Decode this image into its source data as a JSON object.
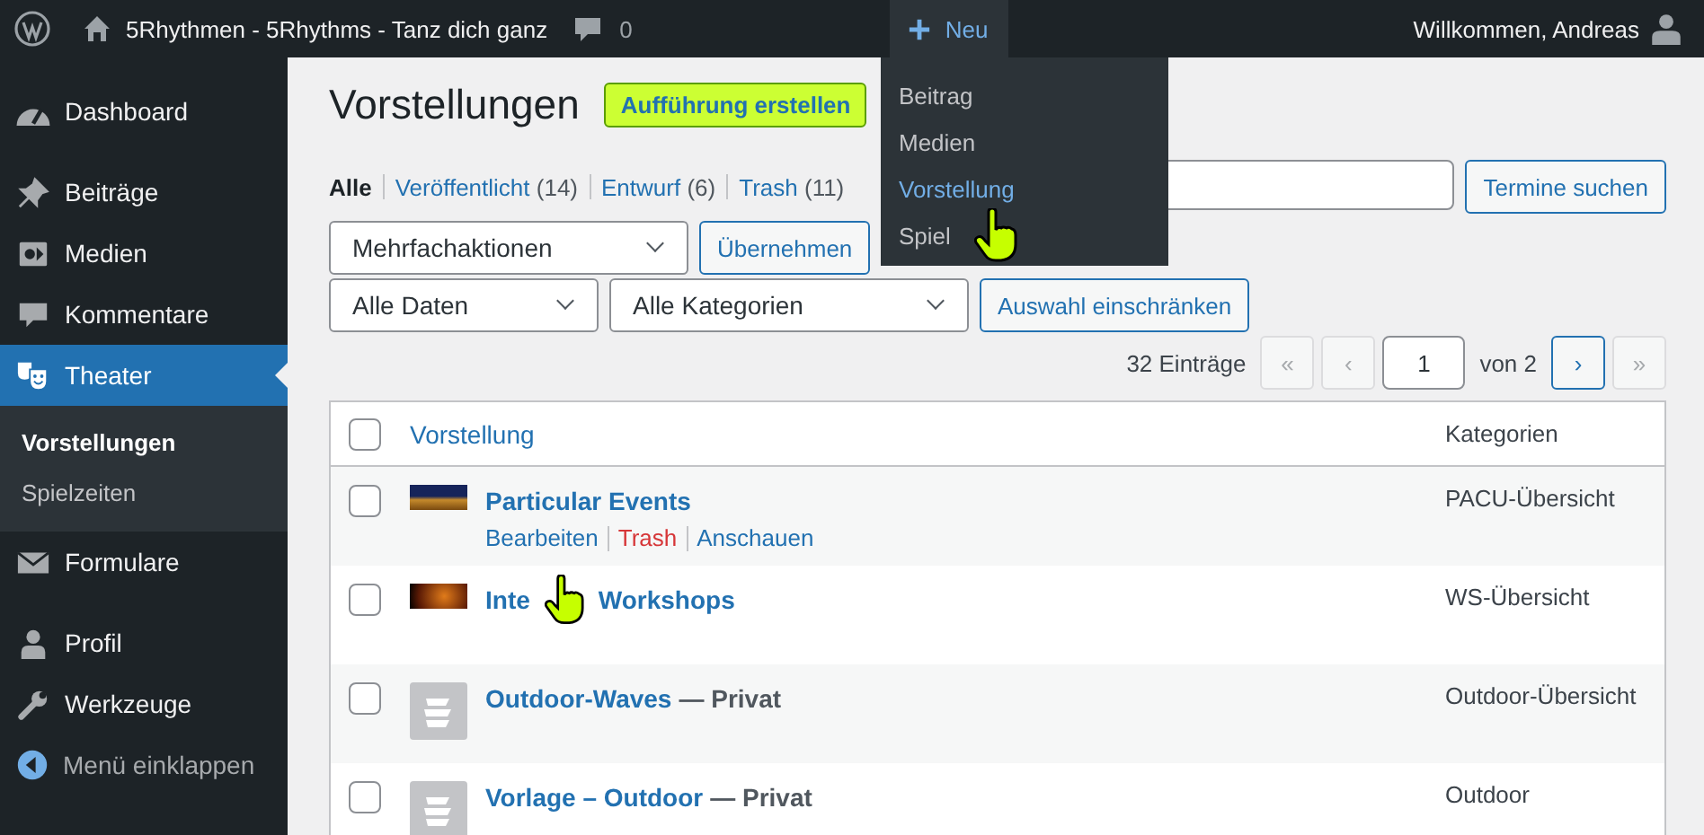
{
  "admin_bar": {
    "site_title": "5Rhythmen - 5Rhythms - Tanz dich ganz",
    "comments_count": "0",
    "new_label": "Neu",
    "greeting": "Willkommen, Andreas"
  },
  "new_menu": {
    "open": true,
    "items": [
      {
        "label": "Beitrag",
        "selected": false
      },
      {
        "label": "Medien",
        "selected": false
      },
      {
        "label": "Vorstellung",
        "selected": true
      },
      {
        "label": "Spiel",
        "selected": false,
        "cursor": true
      }
    ]
  },
  "sidebar": {
    "items": [
      {
        "label": "Dashboard",
        "selected": false
      },
      {
        "label": "Beiträge",
        "selected": false
      },
      {
        "label": "Medien",
        "selected": false
      },
      {
        "label": "Kommentare",
        "selected": false
      },
      {
        "label": "Theater",
        "selected": true,
        "highlighted": true,
        "children": [
          {
            "label": "Vorstellungen",
            "selected": true
          },
          {
            "label": "Spielzeiten",
            "selected": false
          }
        ]
      },
      {
        "label": "Formulare",
        "selected": false
      },
      {
        "label": "Profil",
        "selected": false
      },
      {
        "label": "Werkzeuge",
        "selected": false
      }
    ],
    "collapse_label": "Menü einklappen"
  },
  "page": {
    "title": "Vorstellungen",
    "add_button": {
      "label": "Aufführung erstellen",
      "highlighted": true
    },
    "views": [
      {
        "label": "Alle",
        "selected": true
      },
      {
        "label": "Veröffentlicht",
        "count": "(14)",
        "selected": false
      },
      {
        "label": "Entwurf",
        "count": "(6)",
        "selected": false
      },
      {
        "label": "Trash",
        "count": "(11)",
        "selected": false
      }
    ],
    "search_button": "Termine suchen",
    "bulk_action": "Mehrfachaktionen",
    "apply_button": "Übernehmen",
    "date_filter": "Alle Daten",
    "category_filter": "Alle Kategorien",
    "filter_button": "Auswahl einschränken",
    "items_count": "32 Einträge",
    "pagination": {
      "buttons": [
        {
          "label": "«",
          "disabled": true
        },
        {
          "label": "‹",
          "disabled": true
        }
      ],
      "current_page": "1",
      "total": "von 2",
      "after": [
        {
          "label": "›",
          "disabled": false
        },
        {
          "label": "»",
          "disabled": true
        }
      ]
    }
  },
  "table": {
    "select_all_checked": false,
    "columns": [
      "Vorstellung",
      "Kategorien"
    ],
    "rows": [
      {
        "checked": false,
        "kind": "photo",
        "title": "Particular Events",
        "actions": [
          {
            "label": "Bearbeiten",
            "kind": "edit"
          },
          {
            "label": "Trash",
            "kind": "delete"
          },
          {
            "label": "Anschauen",
            "kind": "view"
          }
        ],
        "category": "PACU-Übersicht"
      },
      {
        "checked": false,
        "kind": "photo",
        "title": "Inte",
        "title_after_cursor": "Workshops",
        "category": "WS-Übersicht"
      },
      {
        "checked": false,
        "kind": "placeholder",
        "title": "Outdoor-Waves",
        "state": "— Privat",
        "category": "Outdoor-Übersicht"
      },
      {
        "checked": false,
        "kind": "placeholder",
        "title": "Vorlage – Outdoor",
        "state": "— Privat",
        "category": "Outdoor"
      }
    ]
  }
}
